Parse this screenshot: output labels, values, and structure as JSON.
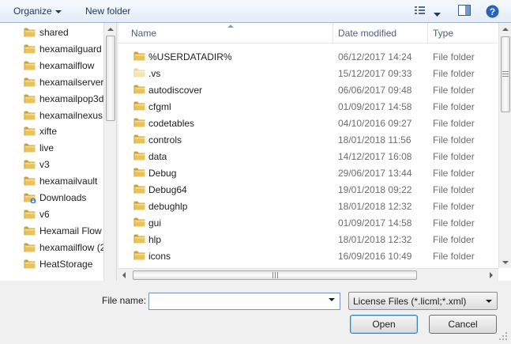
{
  "toolbar": {
    "organize_label": "Organize",
    "new_folder_label": "New folder",
    "views_icon": "view-list-icon",
    "preview_icon": "preview-pane-icon",
    "help_icon": "help-icon"
  },
  "nav": {
    "items": [
      {
        "label": "shared",
        "icon": "folder-icon"
      },
      {
        "label": "hexamailguard",
        "icon": "folder-icon"
      },
      {
        "label": "hexamailflow",
        "icon": "folder-icon"
      },
      {
        "label": "hexamailserver",
        "icon": "folder-icon"
      },
      {
        "label": "hexamailpop3d",
        "icon": "folder-icon"
      },
      {
        "label": "hexamailnexus",
        "icon": "folder-icon"
      },
      {
        "label": "xifte",
        "icon": "folder-icon"
      },
      {
        "label": "live",
        "icon": "folder-icon"
      },
      {
        "label": "v3",
        "icon": "folder-icon"
      },
      {
        "label": "hexamailvault",
        "icon": "folder-icon"
      },
      {
        "label": "Downloads",
        "icon": "downloads-folder-icon"
      },
      {
        "label": "v6",
        "icon": "folder-icon"
      },
      {
        "label": "Hexamail Flow",
        "icon": "folder-icon"
      },
      {
        "label": "hexamailflow (2",
        "icon": "folder-icon"
      },
      {
        "label": "HeatStorage",
        "icon": "folder-icon"
      }
    ]
  },
  "list": {
    "columns": {
      "name": "Name",
      "date": "Date modified",
      "type": "Type"
    },
    "rows": [
      {
        "name": "%USERDATADIR%",
        "date": "06/12/2017 14:24",
        "type": "File folder"
      },
      {
        "name": ".vs",
        "date": "15/12/2017 09:33",
        "type": "File folder",
        "faded": true
      },
      {
        "name": "autodiscover",
        "date": "06/06/2017 09:48",
        "type": "File folder"
      },
      {
        "name": "cfgml",
        "date": "01/09/2017 14:58",
        "type": "File folder"
      },
      {
        "name": "codetables",
        "date": "04/10/2016 09:27",
        "type": "File folder"
      },
      {
        "name": "controls",
        "date": "18/01/2018 11:56",
        "type": "File folder"
      },
      {
        "name": "data",
        "date": "14/12/2017 16:08",
        "type": "File folder"
      },
      {
        "name": "Debug",
        "date": "29/06/2017 13:44",
        "type": "File folder"
      },
      {
        "name": "Debug64",
        "date": "19/01/2018 09:22",
        "type": "File folder"
      },
      {
        "name": "debughlp",
        "date": "18/01/2018 12:32",
        "type": "File folder"
      },
      {
        "name": "gui",
        "date": "01/09/2017 14:58",
        "type": "File folder"
      },
      {
        "name": "hlp",
        "date": "18/01/2018 12:32",
        "type": "File folder"
      },
      {
        "name": "icons",
        "date": "16/09/2016 10:49",
        "type": "File folder"
      }
    ]
  },
  "bottom": {
    "file_name_label": "File name:",
    "file_name_value": "",
    "filter_value": "License Files (*.licml;*.xml)",
    "open_label": "Open",
    "cancel_label": "Cancel"
  },
  "colors": {
    "folder": "#e8c35a",
    "folder_dark": "#c9a033",
    "accent": "#3c7fb1",
    "help": "#2a62b8"
  }
}
